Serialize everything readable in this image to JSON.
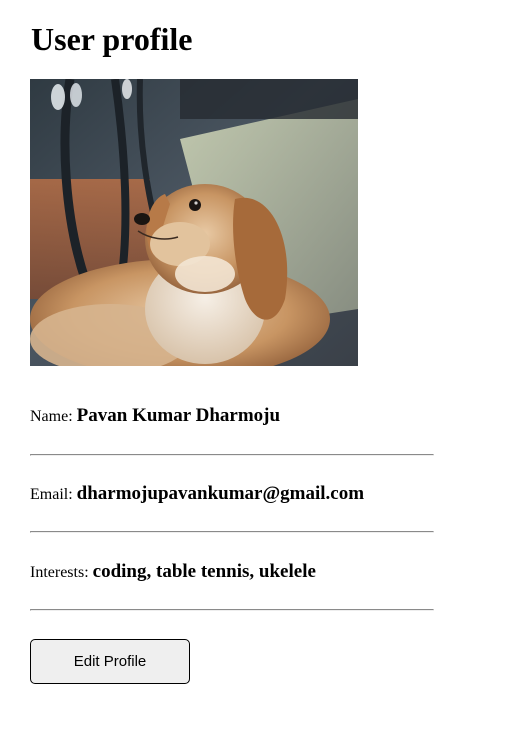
{
  "page": {
    "title": "User profile"
  },
  "profile": {
    "avatar_icon": "dog-photo",
    "name_label": "Name:",
    "name_value": "Pavan Kumar Dharmoju",
    "email_label": "Email:",
    "email_value": "dharmojupavankumar@gmail.com",
    "interests_label": "Interests:",
    "interests_value": "coding, table tennis, ukelele"
  },
  "actions": {
    "edit_label": "Edit Profile"
  },
  "colors": {
    "divider": "#8a8a8a",
    "button_bg": "#efefef",
    "button_border": "#000000"
  }
}
